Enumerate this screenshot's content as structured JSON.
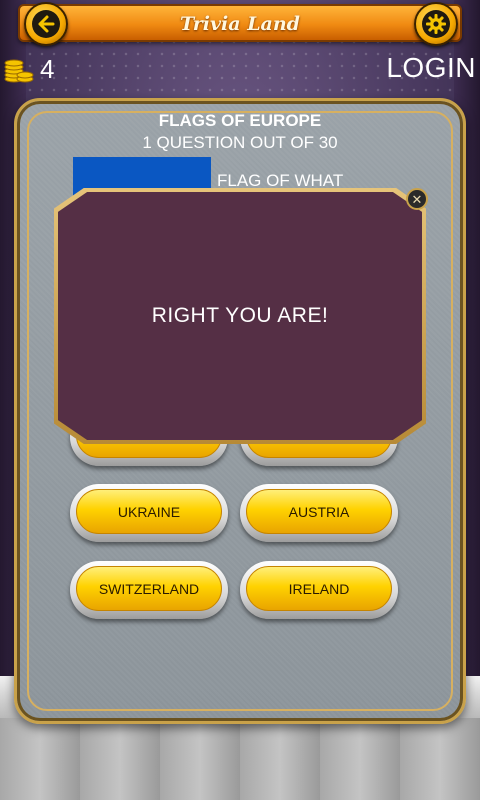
{
  "header": {
    "title": "Trivia Land",
    "back_icon": "arrow-left-icon",
    "settings_icon": "gear-icon"
  },
  "status": {
    "coins": "4",
    "coin_icon": "coin-stack-icon",
    "login_label": "LOGIN"
  },
  "quiz": {
    "title": "FLAGS OF EUROPE",
    "progress": "1 QUESTION OUT OF 30",
    "question": "FLAG OF WHAT"
  },
  "answers": [
    "UKRAINE",
    "AUSTRIA",
    "SWITZERLAND",
    "IRELAND"
  ],
  "modal": {
    "message": "RIGHT YOU ARE!",
    "close_icon": "close-icon"
  },
  "colors": {
    "accent_orange": "#f08a12",
    "answer_yellow": "#ffd200",
    "modal_body": "#552f45",
    "panel_grey": "#8c949a",
    "flag_blue": "#0a57c2",
    "flag_yellow": "#f5c400"
  }
}
